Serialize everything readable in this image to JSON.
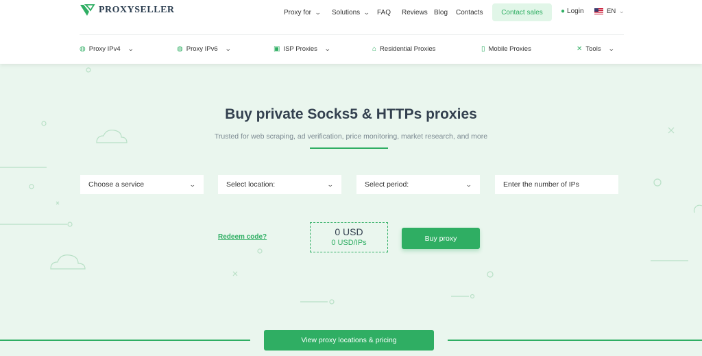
{
  "header": {
    "brand": "PROXYSELLER",
    "nav": [
      {
        "label": "Proxy for",
        "has_dropdown": true
      },
      {
        "label": "Solutions",
        "has_dropdown": true
      },
      {
        "label": "FAQ"
      },
      {
        "label": "Reviews"
      },
      {
        "label": "Blog"
      },
      {
        "label": "Contacts"
      }
    ],
    "contact_sales": "Contact sales",
    "login": "Login",
    "language": "EN"
  },
  "subnav": [
    {
      "label": "Proxy IPv4",
      "icon": "globe-icon",
      "has_dropdown": true
    },
    {
      "label": "Proxy IPv6",
      "icon": "globe-icon",
      "has_dropdown": true
    },
    {
      "label": "ISP Proxies",
      "icon": "server-icon",
      "has_dropdown": true
    },
    {
      "label": "Residential Proxies",
      "icon": "house-icon"
    },
    {
      "label": "Mobile Proxies",
      "icon": "phone-icon"
    },
    {
      "label": "Tools",
      "icon": "tools-icon",
      "has_dropdown": true
    }
  ],
  "hero": {
    "title": "Buy private Socks5 & HTTPs proxies",
    "subtitle": "Trusted for web scraping, ad verification, price monitoring, market research, and more"
  },
  "form": {
    "service": "Choose a service",
    "location": "Select location:",
    "period": "Select period:",
    "ips_placeholder": "Enter the number of IPs"
  },
  "pricing": {
    "redeem": "Redeem code?",
    "total": "0 USD",
    "per_ip": "0 USD/IPs",
    "buy": "Buy proxy"
  },
  "footer_cta": {
    "label": "View proxy locations & pricing"
  },
  "colors": {
    "accent": "#2fae63",
    "hero_bg": "#eaf6ee"
  }
}
